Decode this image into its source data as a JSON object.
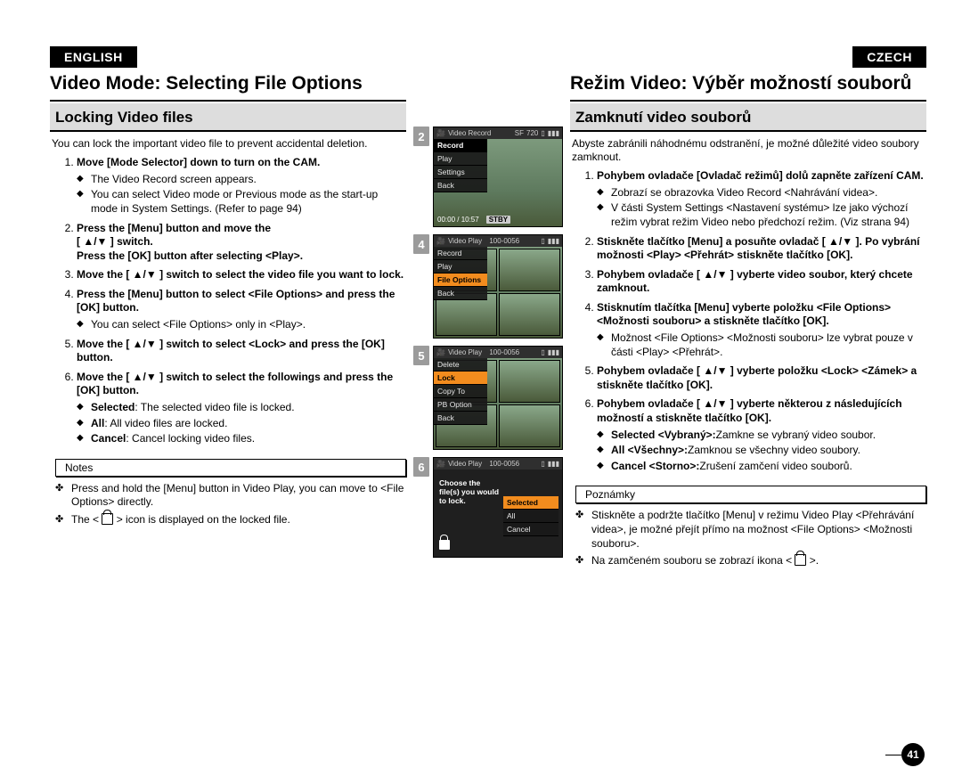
{
  "lang": {
    "english": "ENGLISH",
    "czech": "CZECH"
  },
  "en": {
    "h1": "Video Mode: Selecting File Options",
    "h2": "Locking Video files",
    "intro": "You can lock the important video file to prevent accidental deletion.",
    "steps": {
      "s1_title": "Move [Mode Selector] down to turn on the CAM.",
      "s1_b1": "The Video Record screen appears.",
      "s1_b2": "You can select Video mode or Previous mode as the start-up mode in System Settings. (Refer to page 94)",
      "s2_l1": "Press the [Menu] button and move the",
      "s2_l2": "[ ▲/▼ ] switch.",
      "s2_l3": "Press the [OK] button after selecting <Play>.",
      "s3_t": "Move the [ ▲/▼ ] switch to select the video file you want to lock.",
      "s4_t": "Press the [Menu] button to select <File Options> and press the [OK] button.",
      "s4_b1": "You can select <File Options> only in <Play>.",
      "s5_t": "Move the [ ▲/▼ ] switch to select <Lock> and press the [OK] button.",
      "s6_t": "Move the [ ▲/▼ ] switch to select the followings and press the [OK] button.",
      "s6_b1_pre": "Selected",
      "s6_b1_post": ": The selected video file is locked.",
      "s6_b2_pre": "All",
      "s6_b2_post": ": All video files are locked.",
      "s6_b3_pre": "Cancel",
      "s6_b3_post": ": Cancel locking video files."
    },
    "notes_title": "Notes",
    "notes": {
      "n1": "Press and hold the [Menu] button in Video Play, you can move to <File Options> directly.",
      "n2_pre": "The < ",
      "n2_post": " > icon is displayed on the locked file."
    }
  },
  "cz": {
    "h1": "Režim Video: Výběr možností souborů",
    "h2": "Zamknutí video souborů",
    "intro": "Abyste zabránili náhodnému odstranění, je možné důležité video soubory zamknout.",
    "steps": {
      "s1_t": "Pohybem ovladače [Ovladač režimů] dolů zapněte zařízení CAM.",
      "s1_b1": "Zobrazí se obrazovka Video Record <Nahrávání videa>.",
      "s1_b2": "V části System Settings <Nastavení systému> lze jako výchozí režim vybrat režim Video nebo předchozí režim. (Viz strana 94)",
      "s2_t": "Stiskněte tlačítko [Menu] a posuňte ovladač [ ▲/▼ ]. Po vybrání možnosti <Play> <Přehrát> stiskněte tlačítko [OK].",
      "s3_t": "Pohybem ovladače [ ▲/▼ ] vyberte video soubor, který chcete zamknout.",
      "s4_t": "Stisknutím tlačítka [Menu] vyberte položku <File Options> <Možnosti souboru> a stiskněte tlačítko [OK].",
      "s4_b1": "Možnost <File Options> <Možnosti souboru> lze vybrat pouze v části <Play> <Přehrát>.",
      "s5_t": "Pohybem ovladače [ ▲/▼ ] vyberte položku <Lock> <Zámek> a stiskněte tlačítko [OK].",
      "s6_t": "Pohybem ovladače [ ▲/▼ ] vyberte některou z následujících možností a stiskněte tlačítko [OK].",
      "s6_b1_pre": "Selected <Vybraný>:",
      "s6_b1_post": "Zamkne se vybraný video soubor.",
      "s6_b2_pre": "All <Všechny>:",
      "s6_b2_post": "Zamknou se všechny video soubory.",
      "s6_b3_pre": "Cancel <Storno>:",
      "s6_b3_post": "Zrušení zamčení video souborů."
    },
    "notes_title": "Poznámky",
    "notes": {
      "n1": "Stiskněte a podržte tlačítko [Menu] v režimu Video Play <Přehrávání videa>, je možné přejít přímo na možnost <File Options> <Možnosti souboru>.",
      "n2_pre": "Na zamčeném souboru se zobrazí ikona < ",
      "n2_post": " >."
    }
  },
  "screens": {
    "rec_title": "Video Record",
    "play_title": "Video Play",
    "file_id": "100-0056",
    "sf": "SF",
    "res": "720",
    "menu2": {
      "hdr": "Record",
      "i1": "Record",
      "i2": "Play",
      "i3": "Settings",
      "i4": "Back"
    },
    "time": "00:00 / 10:57",
    "stby": "STBY",
    "menu4": {
      "i1": "Record",
      "i2": "Play",
      "i3": "File Options",
      "i4": "Back"
    },
    "menu5": {
      "i1": "Delete",
      "i2": "Lock",
      "i3": "Copy To",
      "i4": "PB Option",
      "i5": "Back"
    },
    "prompt6": "Choose the file(s) you would to lock.",
    "dlg6": {
      "i1": "Selected",
      "i2": "All",
      "i3": "Cancel"
    },
    "nums": {
      "n2": "2",
      "n4": "4",
      "n5": "5",
      "n6": "6"
    }
  },
  "page_num": "41"
}
